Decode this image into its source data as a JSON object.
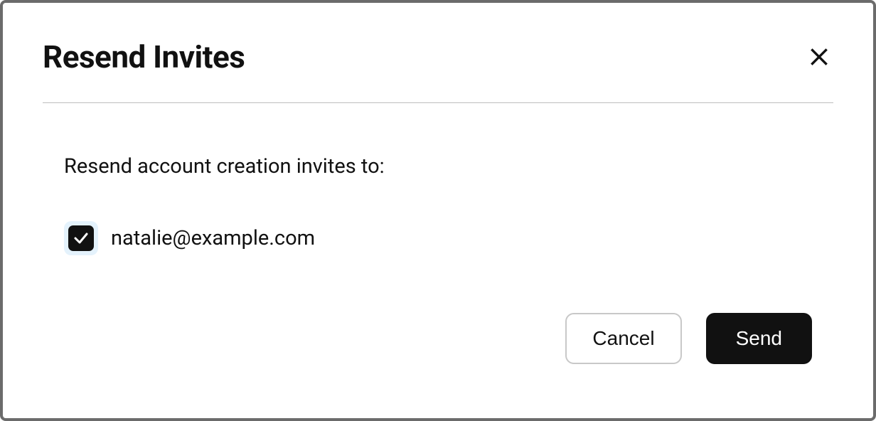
{
  "dialog": {
    "title": "Resend Invites",
    "prompt": "Resend account creation invites to:",
    "invites": [
      {
        "email": "natalie@example.com",
        "checked": true
      }
    ],
    "buttons": {
      "cancel": "Cancel",
      "send": "Send"
    }
  }
}
